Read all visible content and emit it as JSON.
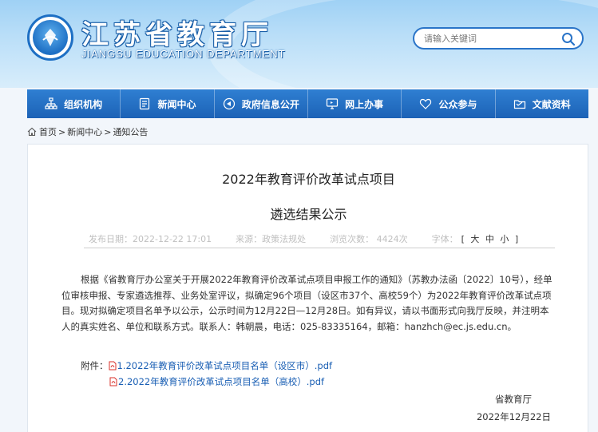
{
  "header": {
    "logo_cn": "江苏省教育厅",
    "logo_en": "JIANGSU EDUCATION DEPARTMENT",
    "search_placeholder": "请输入关键词"
  },
  "nav": {
    "items": [
      {
        "label": "组织机构",
        "icon": "org-chart-icon"
      },
      {
        "label": "新闻中心",
        "icon": "document-icon"
      },
      {
        "label": "政府信息公开",
        "icon": "speaker-icon"
      },
      {
        "label": "网上办事",
        "icon": "monitor-icon"
      },
      {
        "label": "公众参与",
        "icon": "heart-icon"
      },
      {
        "label": "文献资料",
        "icon": "folder-icon"
      }
    ]
  },
  "breadcrumb": {
    "home": "首页",
    "sep": ">",
    "news": "新闻中心",
    "notice": "通知公告"
  },
  "article": {
    "title_line1": "2022年教育评价改革试点项目",
    "title_line2": "遴选结果公示",
    "publish_label": "发布日期：2022-12-22 17:01",
    "source_label": "来源：政策法规处",
    "views_label": "浏览次数： 4424次",
    "fontsize_label": "字体：",
    "fontsize_open": "[",
    "fontsize_close": "]",
    "font_large": "大",
    "font_medium": "中",
    "font_small": "小",
    "body": "根据《省教育厅办公室关于开展2022年教育评价改革试点项目申报工作的通知》（苏教办法函〔2022〕10号），经单位审核申报、专家遴选推荐、业务处室评议，拟确定96个项目（设区市37个、高校59个）为2022年教育评价改革试点项目。现对拟确定项目名单予以公示，公示时间为12月22日—12月28日。如有异议，请以书面形式向我厅反映，并注明本人的真实姓名、单位和联系方式。联系人：韩朝晨，电话：025-83335164，邮箱：hanzhch@ec.js.edu.cn。",
    "attachment_label": "附件：",
    "attachment1": "1.2022年教育评价改革试点项目名单（设区市）.pdf",
    "attachment2": "2.2022年教育评价改革试点项目名单（高校）.pdf",
    "signature": "省教育厅",
    "date": "2022年12月22日"
  },
  "colors": {
    "nav_bg": "#1f67bd",
    "link": "#1a5fb4",
    "meta_text": "#bfbfbf",
    "pdf_red": "#d9302a"
  }
}
